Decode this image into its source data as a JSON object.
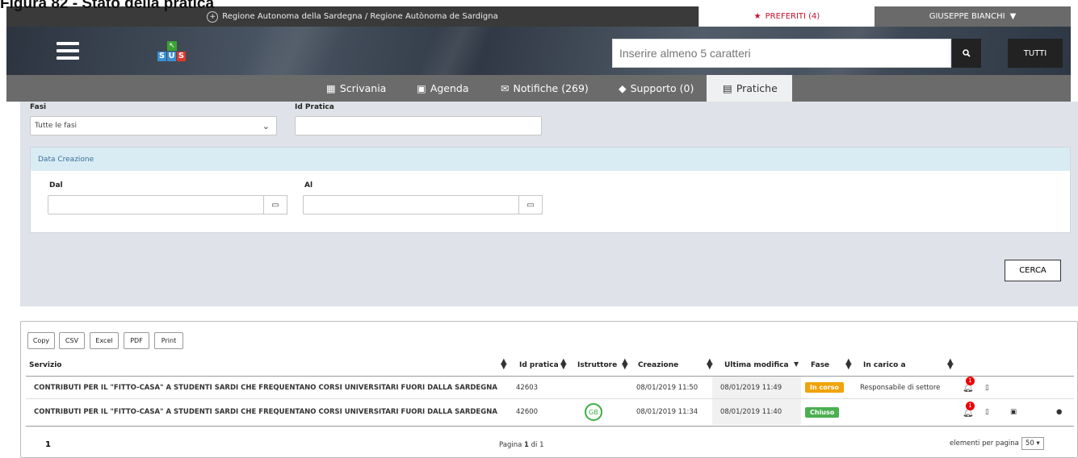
{
  "caption": "Figura 82 - Stato della pratica",
  "topbar": {
    "region_text": "Regione Autonoma della Sardegna / Regione Autònoma de Sardigna",
    "preferiti": "PREFERITI (4)",
    "user": "GIUSEPPE BIANCHI"
  },
  "header": {
    "logo_letters": [
      "S",
      "U",
      "S"
    ],
    "search_placeholder": "Inserire almeno 5 caratteri",
    "tutti": "TUTTI"
  },
  "nav": [
    {
      "label": "Scrivania",
      "icon": "dashboard-icon"
    },
    {
      "label": "Agenda",
      "icon": "agenda-icon"
    },
    {
      "label": "Notifiche (269)",
      "icon": "envelope-icon"
    },
    {
      "label": "Supporto (0)",
      "icon": "tag-icon"
    },
    {
      "label": "Pratiche",
      "icon": "document-icon",
      "active": true
    }
  ],
  "filters": {
    "fasi_label": "Fasi",
    "fasi_value": "Tutte le fasi",
    "id_label": "Id Pratica",
    "id_value": "",
    "panel_title": "Data Creazione",
    "dal_label": "Dal",
    "al_label": "Al",
    "cerca": "CERCA"
  },
  "export_buttons": [
    "Copy",
    "CSV",
    "Excel",
    "PDF",
    "Print"
  ],
  "table": {
    "headers": {
      "servizio": "Servizio",
      "id": "Id pratica",
      "istruttore": "Istruttore",
      "creazione": "Creazione",
      "ultima": "Ultima modifica",
      "fase": "Fase",
      "carico": "In carico a"
    },
    "rows": [
      {
        "servizio": "CONTRIBUTI PER IL \"FITTO-CASA\" A STUDENTI SARDI CHE FREQUENTANO CORSI UNIVERSITARI FUORI DALLA SARDEGNA",
        "id": "42603",
        "istruttore": "",
        "creazione": "08/01/2019 11:50",
        "ultima": "08/01/2019 11:49",
        "fase": "In corso",
        "fase_color": "#f0a30a",
        "carico": "Responsabile di settore",
        "notifications": "1"
      },
      {
        "servizio": "CONTRIBUTI PER IL \"FITTO-CASA\" A STUDENTI SARDI CHE FREQUENTANO CORSI UNIVERSITARI FUORI DALLA SARDEGNA",
        "id": "42600",
        "istruttore": "GB",
        "creazione": "08/01/2019 11:34",
        "ultima": "08/01/2019 11:40",
        "fase": "Chiuso",
        "fase_color": "#4caf50",
        "carico": "",
        "notifications": "1"
      }
    ]
  },
  "pagination": {
    "current": "1",
    "info_prefix": "Pagina ",
    "info_page": "1",
    "info_suffix": " di 1",
    "per_page_label": "elementi per pagina",
    "per_page": "50"
  }
}
